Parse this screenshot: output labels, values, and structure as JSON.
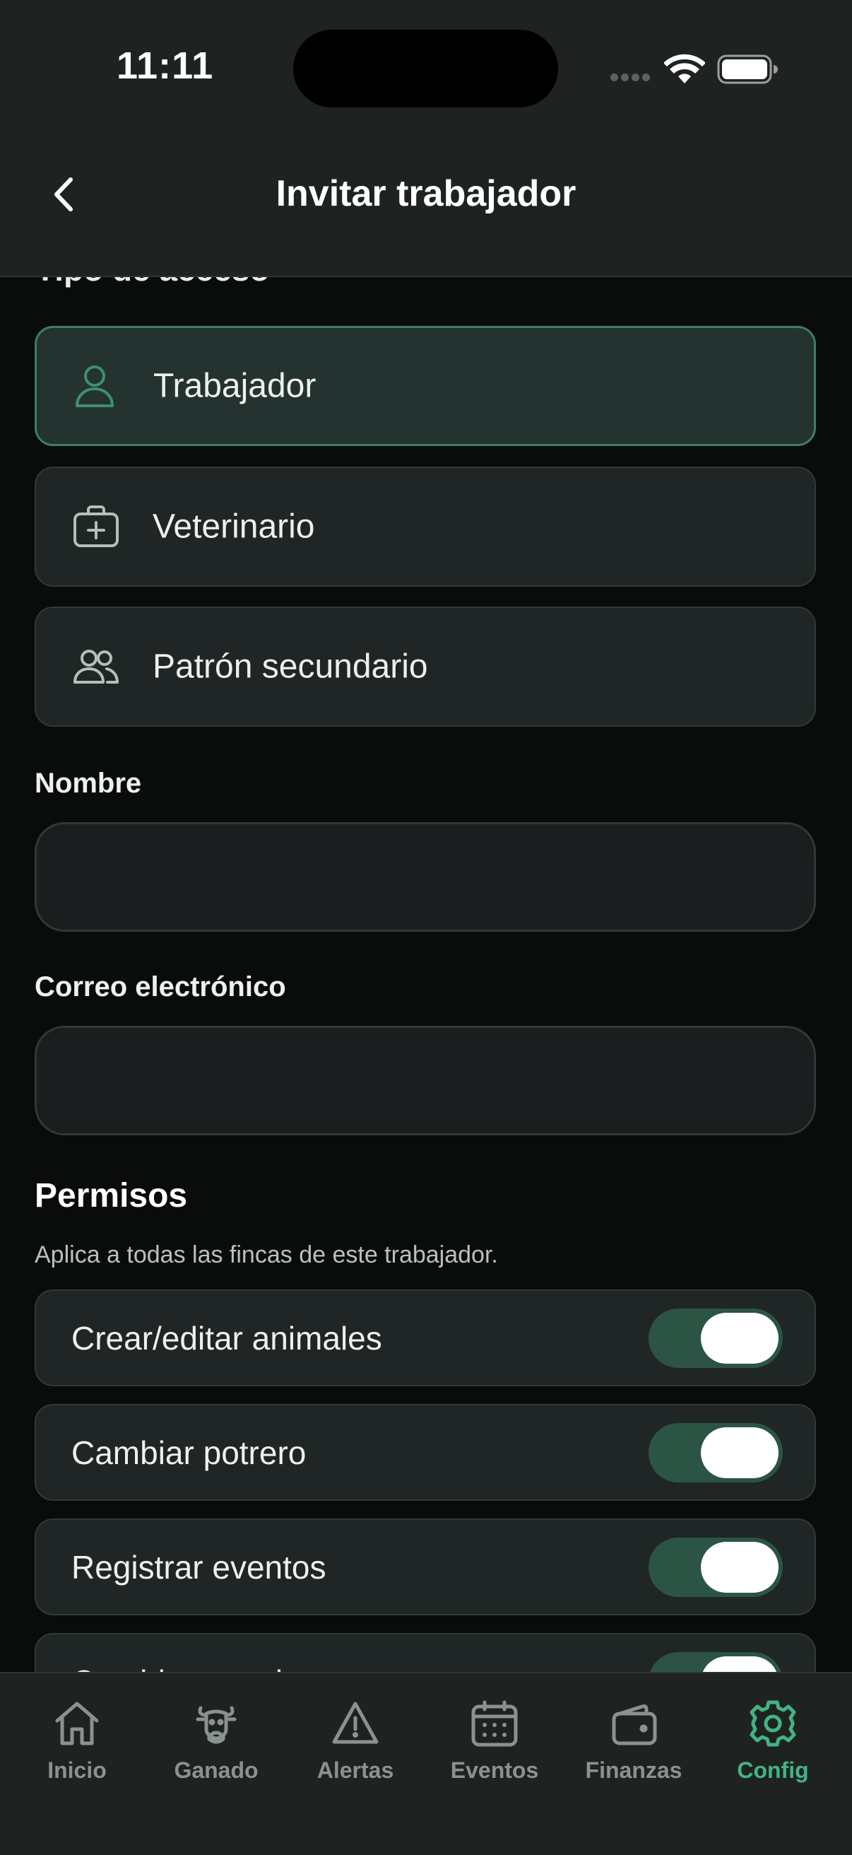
{
  "status_bar": {
    "time": "11:11"
  },
  "header": {
    "title": "Invitar trabajador"
  },
  "access_section": {
    "title": "Tipo de acceso",
    "options": [
      {
        "label": "Trabajador",
        "icon": "person-icon",
        "selected": true
      },
      {
        "label": "Veterinario",
        "icon": "medical-kit-icon",
        "selected": false
      },
      {
        "label": "Patrón secundario",
        "icon": "people-icon",
        "selected": false
      }
    ]
  },
  "form": {
    "name_label": "Nombre",
    "name_value": "",
    "email_label": "Correo electrónico",
    "email_value": ""
  },
  "permissions": {
    "title": "Permisos",
    "subtitle": "Aplica a todas las fincas de este trabajador.",
    "items": [
      {
        "label": "Crear/editar animales",
        "enabled": true
      },
      {
        "label": "Cambiar potrero",
        "enabled": true
      },
      {
        "label": "Registrar eventos",
        "enabled": true
      },
      {
        "label": "Cambiar estado",
        "enabled": true
      }
    ]
  },
  "tabbar": {
    "tabs": [
      {
        "label": "Inicio",
        "icon": "home-icon",
        "active": false
      },
      {
        "label": "Ganado",
        "icon": "cow-icon",
        "active": false
      },
      {
        "label": "Alertas",
        "icon": "warning-icon",
        "active": false
      },
      {
        "label": "Eventos",
        "icon": "calendar-icon",
        "active": false
      },
      {
        "label": "Finanzas",
        "icon": "wallet-icon",
        "active": false
      },
      {
        "label": "Config",
        "icon": "gear-icon",
        "active": true
      }
    ]
  },
  "colors": {
    "background": "#0a0c0c",
    "header": "#1e2322",
    "card": "#1f2625",
    "accent": "#43b383",
    "toggle_on": "#2c5445",
    "muted": "#8a9290"
  }
}
